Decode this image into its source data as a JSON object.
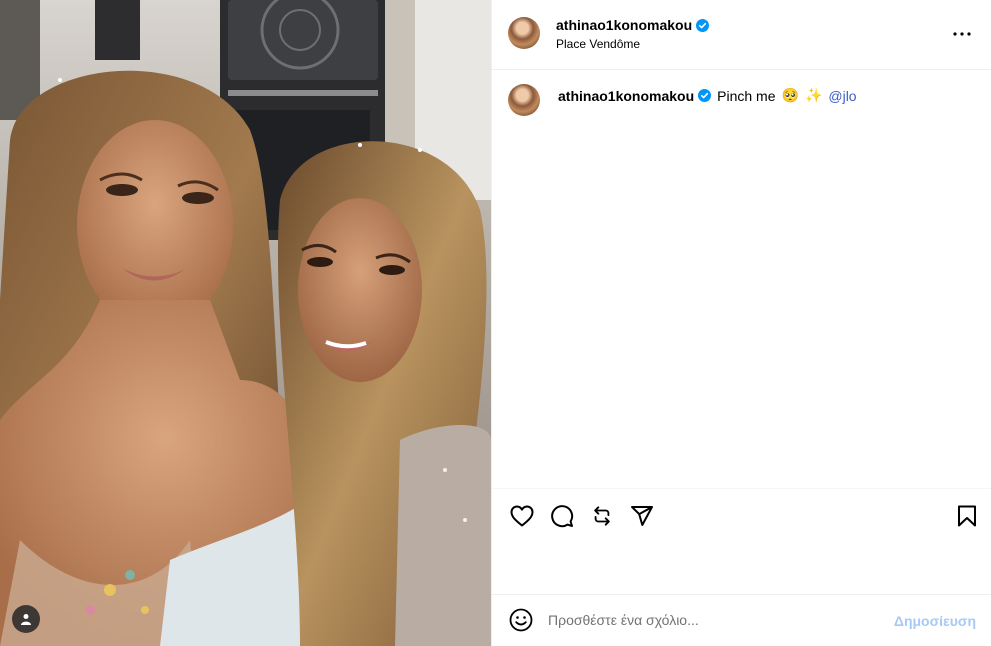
{
  "post": {
    "username": "athinao1konomakou",
    "verified": true,
    "location": "Place Vendôme",
    "more_icon": "more-horizontal-icon"
  },
  "caption": {
    "username": "athinao1konomakou",
    "text": "Pinch me",
    "emojis": [
      "🥺",
      "✨"
    ],
    "mention": "@jlo"
  },
  "actions": {
    "like_icon": "heart-icon",
    "comment_icon": "comment-bubble-icon",
    "repost_icon": "repost-icon",
    "share_icon": "paper-plane-icon",
    "save_icon": "bookmark-icon"
  },
  "comment_box": {
    "placeholder": "Προσθέστε ένα σχόλιο...",
    "post_label": "Δημοσίευση",
    "emoji_icon": "smiley-icon"
  },
  "media": {
    "tag_icon": "user-tag-icon"
  },
  "colors": {
    "verified_blue": "#0095f6",
    "mention_blue": "#3d5fc4",
    "post_button_disabled": "#a6c9f5",
    "divider": "#efefef"
  }
}
